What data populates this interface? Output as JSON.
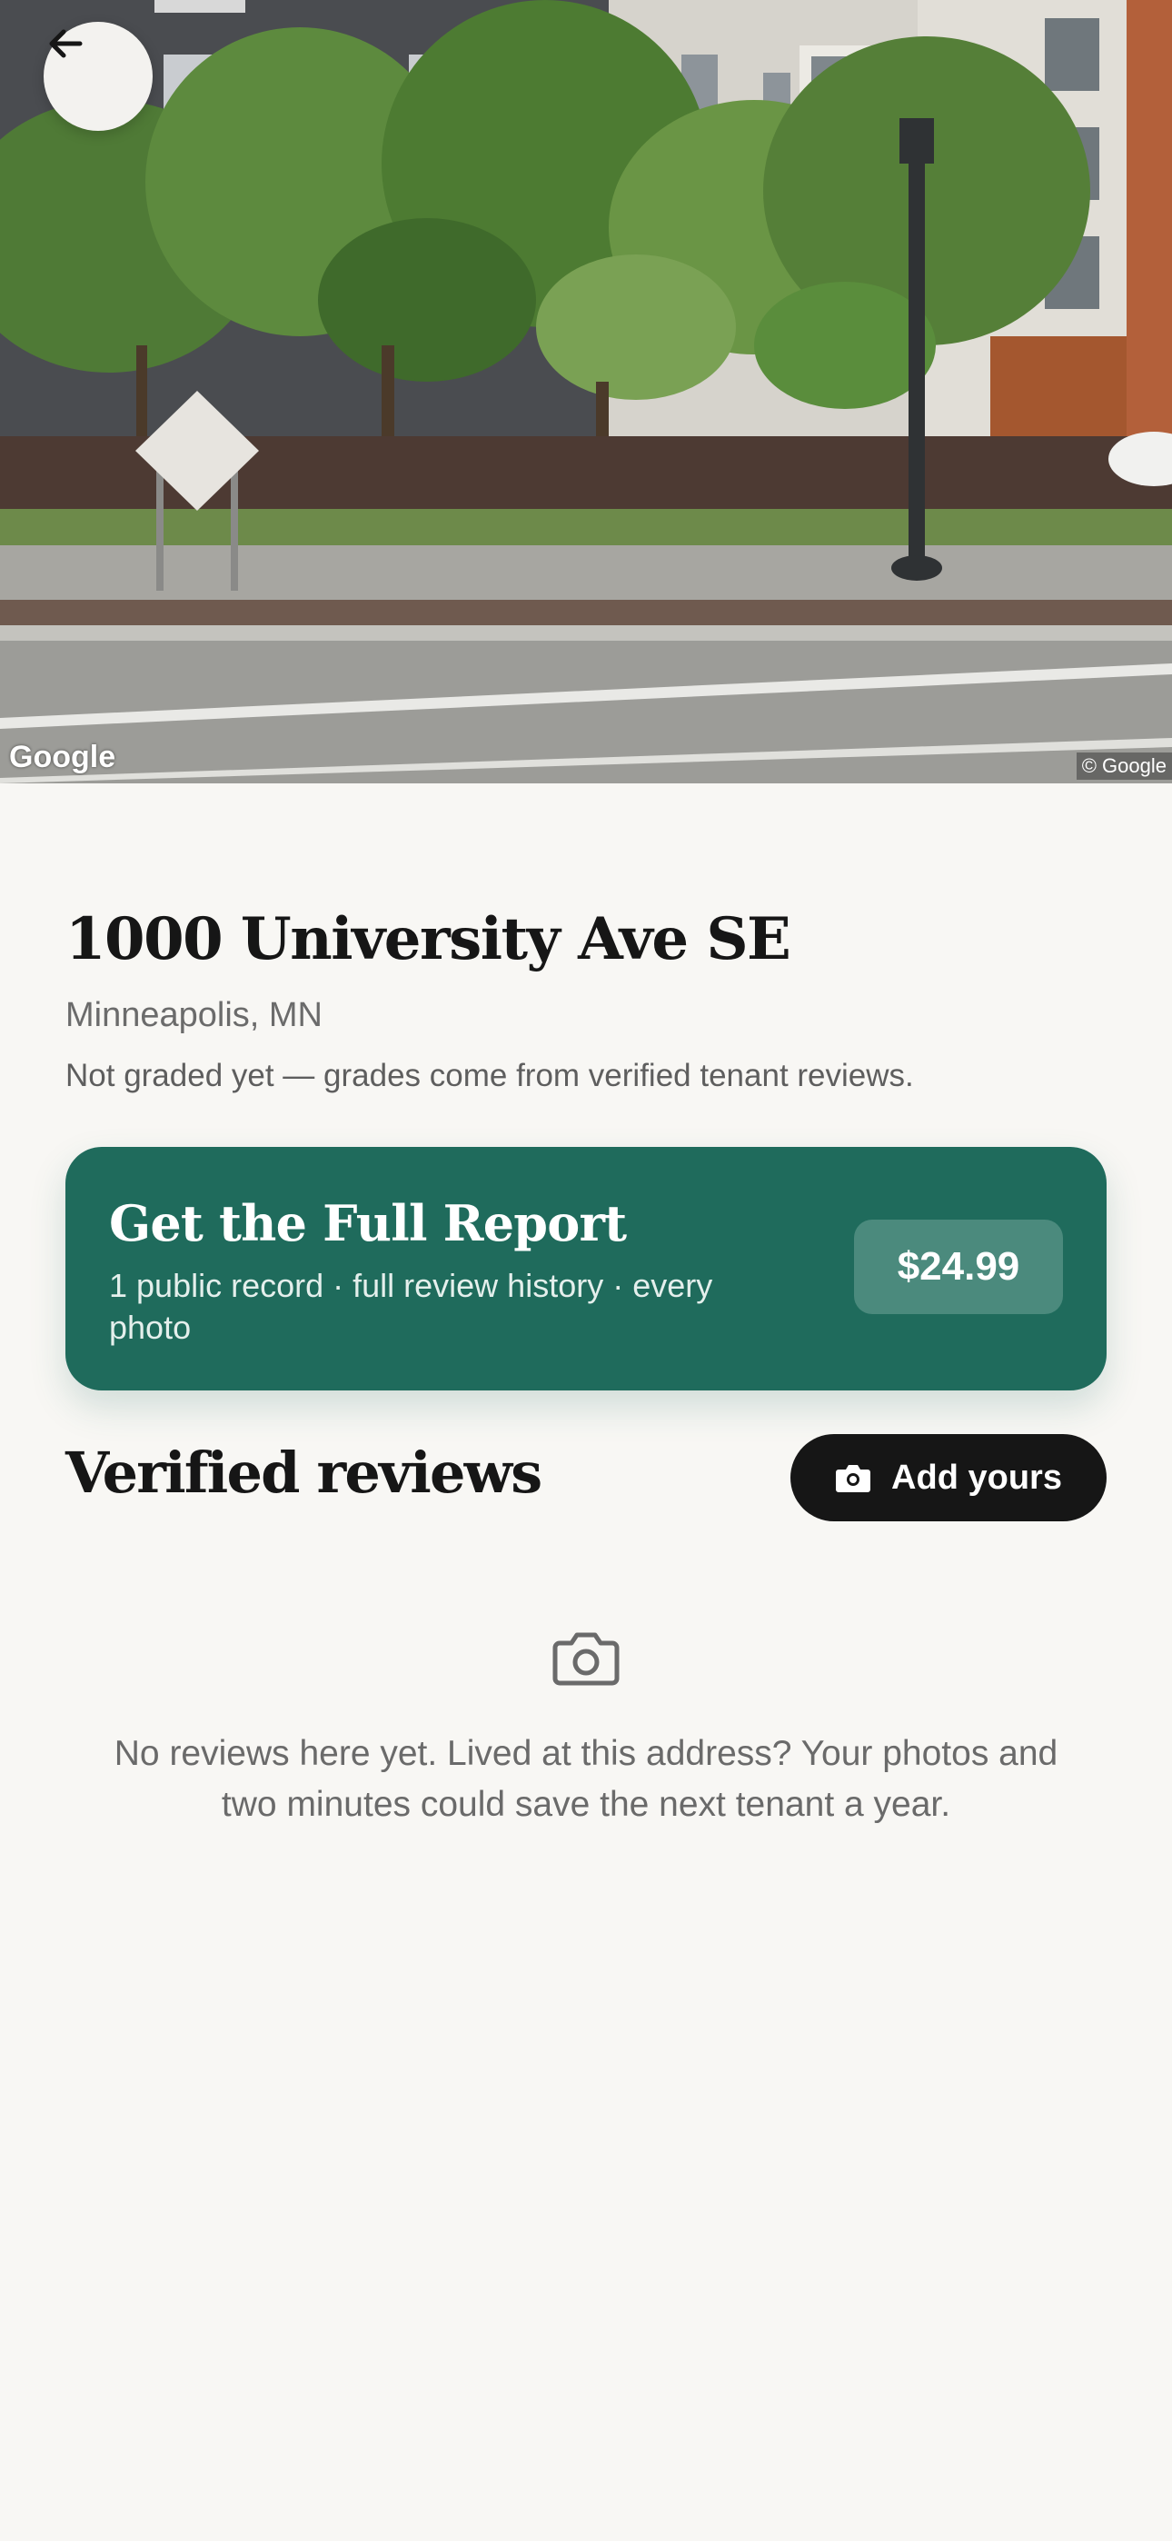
{
  "hero": {
    "google_watermark": "Google",
    "copyright": "© Google"
  },
  "nav": {
    "back_icon": "arrow-left-icon"
  },
  "property": {
    "address": "1000 University Ave SE",
    "city": "Minneapolis, MN",
    "grade_note": "Not graded yet — grades come from verified tenant reviews."
  },
  "report": {
    "title": "Get the Full Report",
    "subtitle": "1 public record · full review history · every photo",
    "price": "$24.99",
    "colors": {
      "card": "#1f6b5c",
      "pill": "#4b8a7d"
    }
  },
  "reviews": {
    "heading": "Verified reviews",
    "add_label": "Add yours",
    "add_icon": "camera-icon",
    "empty_icon": "camera-outline-icon",
    "empty_text": "No reviews here yet. Lived at this address? Your photos and two minutes could save the next tenant a year."
  }
}
